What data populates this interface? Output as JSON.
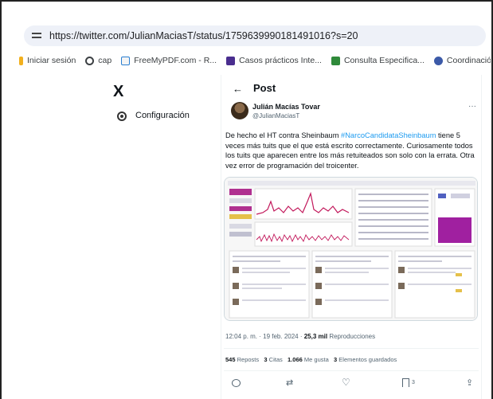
{
  "browser": {
    "url": "https://twitter.com/JulianMaciasT/status/1759639990181491016?s=20",
    "bookmarks": [
      {
        "label": "Iniciar sesión",
        "icon": "bookmark-bar-icon"
      },
      {
        "label": "cap",
        "icon": "globe-icon"
      },
      {
        "label": "FreeMyPDF.com - R...",
        "icon": "pdf-icon"
      },
      {
        "label": "Casos prácticos Inte...",
        "icon": "em-icon"
      },
      {
        "label": "Consulta Especifica...",
        "icon": "book-icon"
      },
      {
        "label": "Coordinación de l",
        "icon": "seal-icon"
      }
    ]
  },
  "nav": {
    "logo": "X",
    "settings_label": "Configuración"
  },
  "post": {
    "back_arrow": "←",
    "header": "Post",
    "author_name": "Julián Macías Tovar",
    "author_handle": "@JulianMaciasT",
    "more": "···",
    "text_before": "De hecho el HT contra Sheinbaum ",
    "hashtag": "#NarcoCandidataSheinbaum",
    "text_after": " tiene 5 veces más tuits que el que está escrito correctamente. Curiosamente todos los tuits que aparecen entre los más retuiteados son solo con la errata. Otra vez error de programación del troicenter.",
    "timestamp": "12:04 p. m. · 19 feb. 2024 · ",
    "views_count": "25,3 mil",
    "views_label": " Reproducciones",
    "stats": [
      {
        "count": "545",
        "label": "Reposts"
      },
      {
        "count": "3",
        "label": "Citas"
      },
      {
        "count": "1.066",
        "label": "Me gusta"
      },
      {
        "count": "3",
        "label": "Elementos guardados"
      }
    ],
    "bookmark_count": "3"
  },
  "colors": {
    "accent": "#1d9bf0",
    "chart_pink": "#c2185b",
    "chart_purple": "#a020a0"
  }
}
